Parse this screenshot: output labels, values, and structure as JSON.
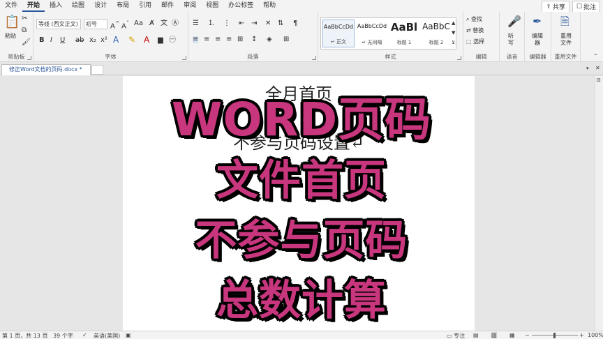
{
  "menu": {
    "tabs": [
      "文件",
      "开始",
      "插入",
      "绘图",
      "设计",
      "布局",
      "引用",
      "邮件",
      "审阅",
      "视图",
      "办公标签",
      "帮助"
    ],
    "active": "开始",
    "share_label": "共享",
    "comment_label": "批注"
  },
  "ribbon": {
    "clipboard": {
      "paste_label": "粘贴",
      "group_label": "剪贴板"
    },
    "font": {
      "font_name": "等线 (西文正文)",
      "font_size": "初号",
      "group_label": "字体"
    },
    "paragraph": {
      "group_label": "段落"
    },
    "styles": {
      "group_label": "样式",
      "items": [
        {
          "preview": "AaBbCcDd",
          "name": "↵ 正文"
        },
        {
          "preview": "AaBbCcDd",
          "name": "↵ 无间隔"
        },
        {
          "preview": "AaBl",
          "name": "标题 1"
        },
        {
          "preview": "AaBbC",
          "name": "标题 2"
        }
      ]
    },
    "editing": {
      "find_label": "查找",
      "replace_label": "替换",
      "select_label": "选择",
      "group_label": "编辑"
    },
    "voice": {
      "button_label": "听写",
      "group_label": "语音"
    },
    "editor": {
      "button_label": "编辑器",
      "group_label": "编辑器"
    },
    "reuse": {
      "button_label": "重用文件",
      "group_label": "重用文件"
    }
  },
  "document": {
    "tab_title": "修正Word文档的页码.docx *",
    "line1": "全月首页",
    "line2": "不参与页码设置↵"
  },
  "overlay": {
    "line1": "WORD页码",
    "line2": "文件首页",
    "line3": "不参与页码",
    "line4": "总数计算"
  },
  "status": {
    "page_info": "第 1 页，共 13 页",
    "word_count": "39 个字",
    "language": "英语(美国)",
    "focus_label": "专注",
    "zoom": "100%"
  }
}
